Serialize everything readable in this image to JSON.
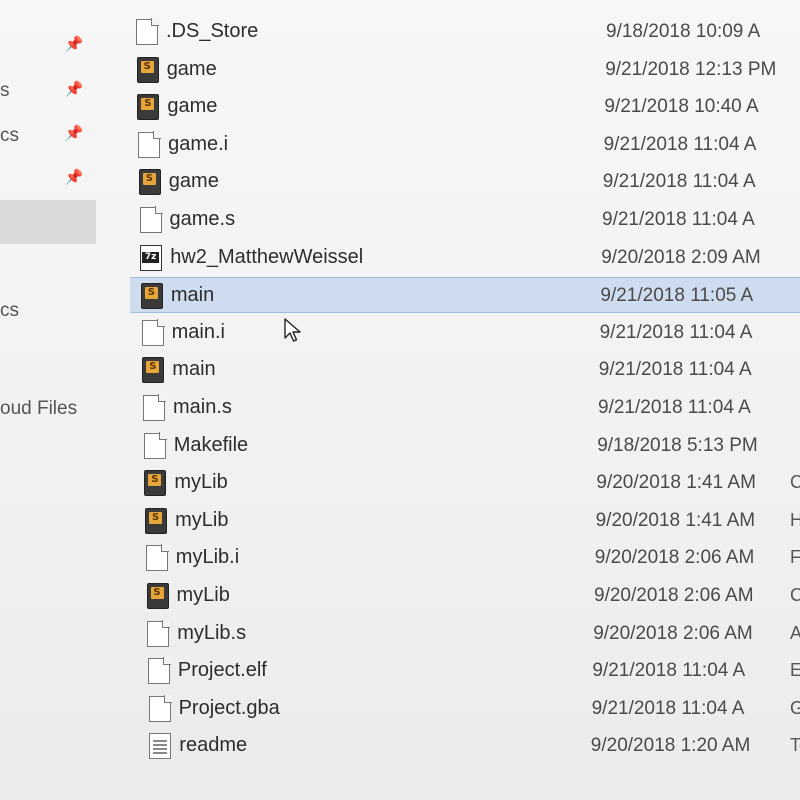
{
  "nav": {
    "pins": [
      "pin-icon",
      "pin-icon",
      "pin-icon",
      "pin-icon"
    ],
    "labels": [
      "s",
      "cs",
      "cs",
      "oud Files"
    ]
  },
  "files": [
    {
      "name": ".DS_Store",
      "icon": "blank-file-icon",
      "modified": "9/18/2018 10:09 A",
      "type": ""
    },
    {
      "name": "game",
      "icon": "assembly-file-icon",
      "modified": "9/21/2018 12:13 PM",
      "type": ""
    },
    {
      "name": "game",
      "icon": "assembly-file-icon",
      "modified": "9/21/2018 10:40 A",
      "type": ""
    },
    {
      "name": "game.i",
      "icon": "blank-file-icon",
      "modified": "9/21/2018 11:04 A",
      "type": ""
    },
    {
      "name": "game",
      "icon": "assembly-file-icon",
      "modified": "9/21/2018 11:04 A",
      "type": ""
    },
    {
      "name": "game.s",
      "icon": "blank-file-icon",
      "modified": "9/21/2018 11:04 A",
      "type": ""
    },
    {
      "name": "hw2_MatthewWeissel",
      "icon": "7z-archive-icon",
      "modified": "9/20/2018 2:09 AM",
      "type": ""
    },
    {
      "name": "main",
      "icon": "assembly-file-icon",
      "modified": "9/21/2018 11:05 A",
      "type": "",
      "selected": true
    },
    {
      "name": "main.i",
      "icon": "blank-file-icon",
      "modified": "9/21/2018 11:04 A",
      "type": ""
    },
    {
      "name": "main",
      "icon": "assembly-file-icon",
      "modified": "9/21/2018 11:04 A",
      "type": ""
    },
    {
      "name": "main.s",
      "icon": "blank-file-icon",
      "modified": "9/21/2018 11:04 A",
      "type": ""
    },
    {
      "name": "Makefile",
      "icon": "blank-file-icon",
      "modified": "9/18/2018 5:13 PM",
      "type": ""
    },
    {
      "name": "myLib",
      "icon": "assembly-file-icon",
      "modified": "9/20/2018 1:41 AM",
      "type": "C"
    },
    {
      "name": "myLib",
      "icon": "assembly-file-icon",
      "modified": "9/20/2018 1:41 AM",
      "type": "H"
    },
    {
      "name": "myLib.i",
      "icon": "blank-file-icon",
      "modified": "9/20/2018 2:06 AM",
      "type": "F"
    },
    {
      "name": "myLib",
      "icon": "assembly-file-icon",
      "modified": "9/20/2018 2:06 AM",
      "type": "C"
    },
    {
      "name": "myLib.s",
      "icon": "blank-file-icon",
      "modified": "9/20/2018 2:06 AM",
      "type": "A"
    },
    {
      "name": "Project.elf",
      "icon": "blank-file-icon",
      "modified": "9/21/2018 11:04 A",
      "type": "E"
    },
    {
      "name": "Project.gba",
      "icon": "blank-file-icon",
      "modified": "9/21/2018 11:04 A",
      "type": "G"
    },
    {
      "name": "readme",
      "icon": "text-file-icon",
      "modified": "9/20/2018 1:20 AM",
      "type": "Te"
    }
  ],
  "colors": {
    "selection": "#cddcee",
    "selection_border": "#9fbde0",
    "asm_badge": "#e7a63a"
  }
}
